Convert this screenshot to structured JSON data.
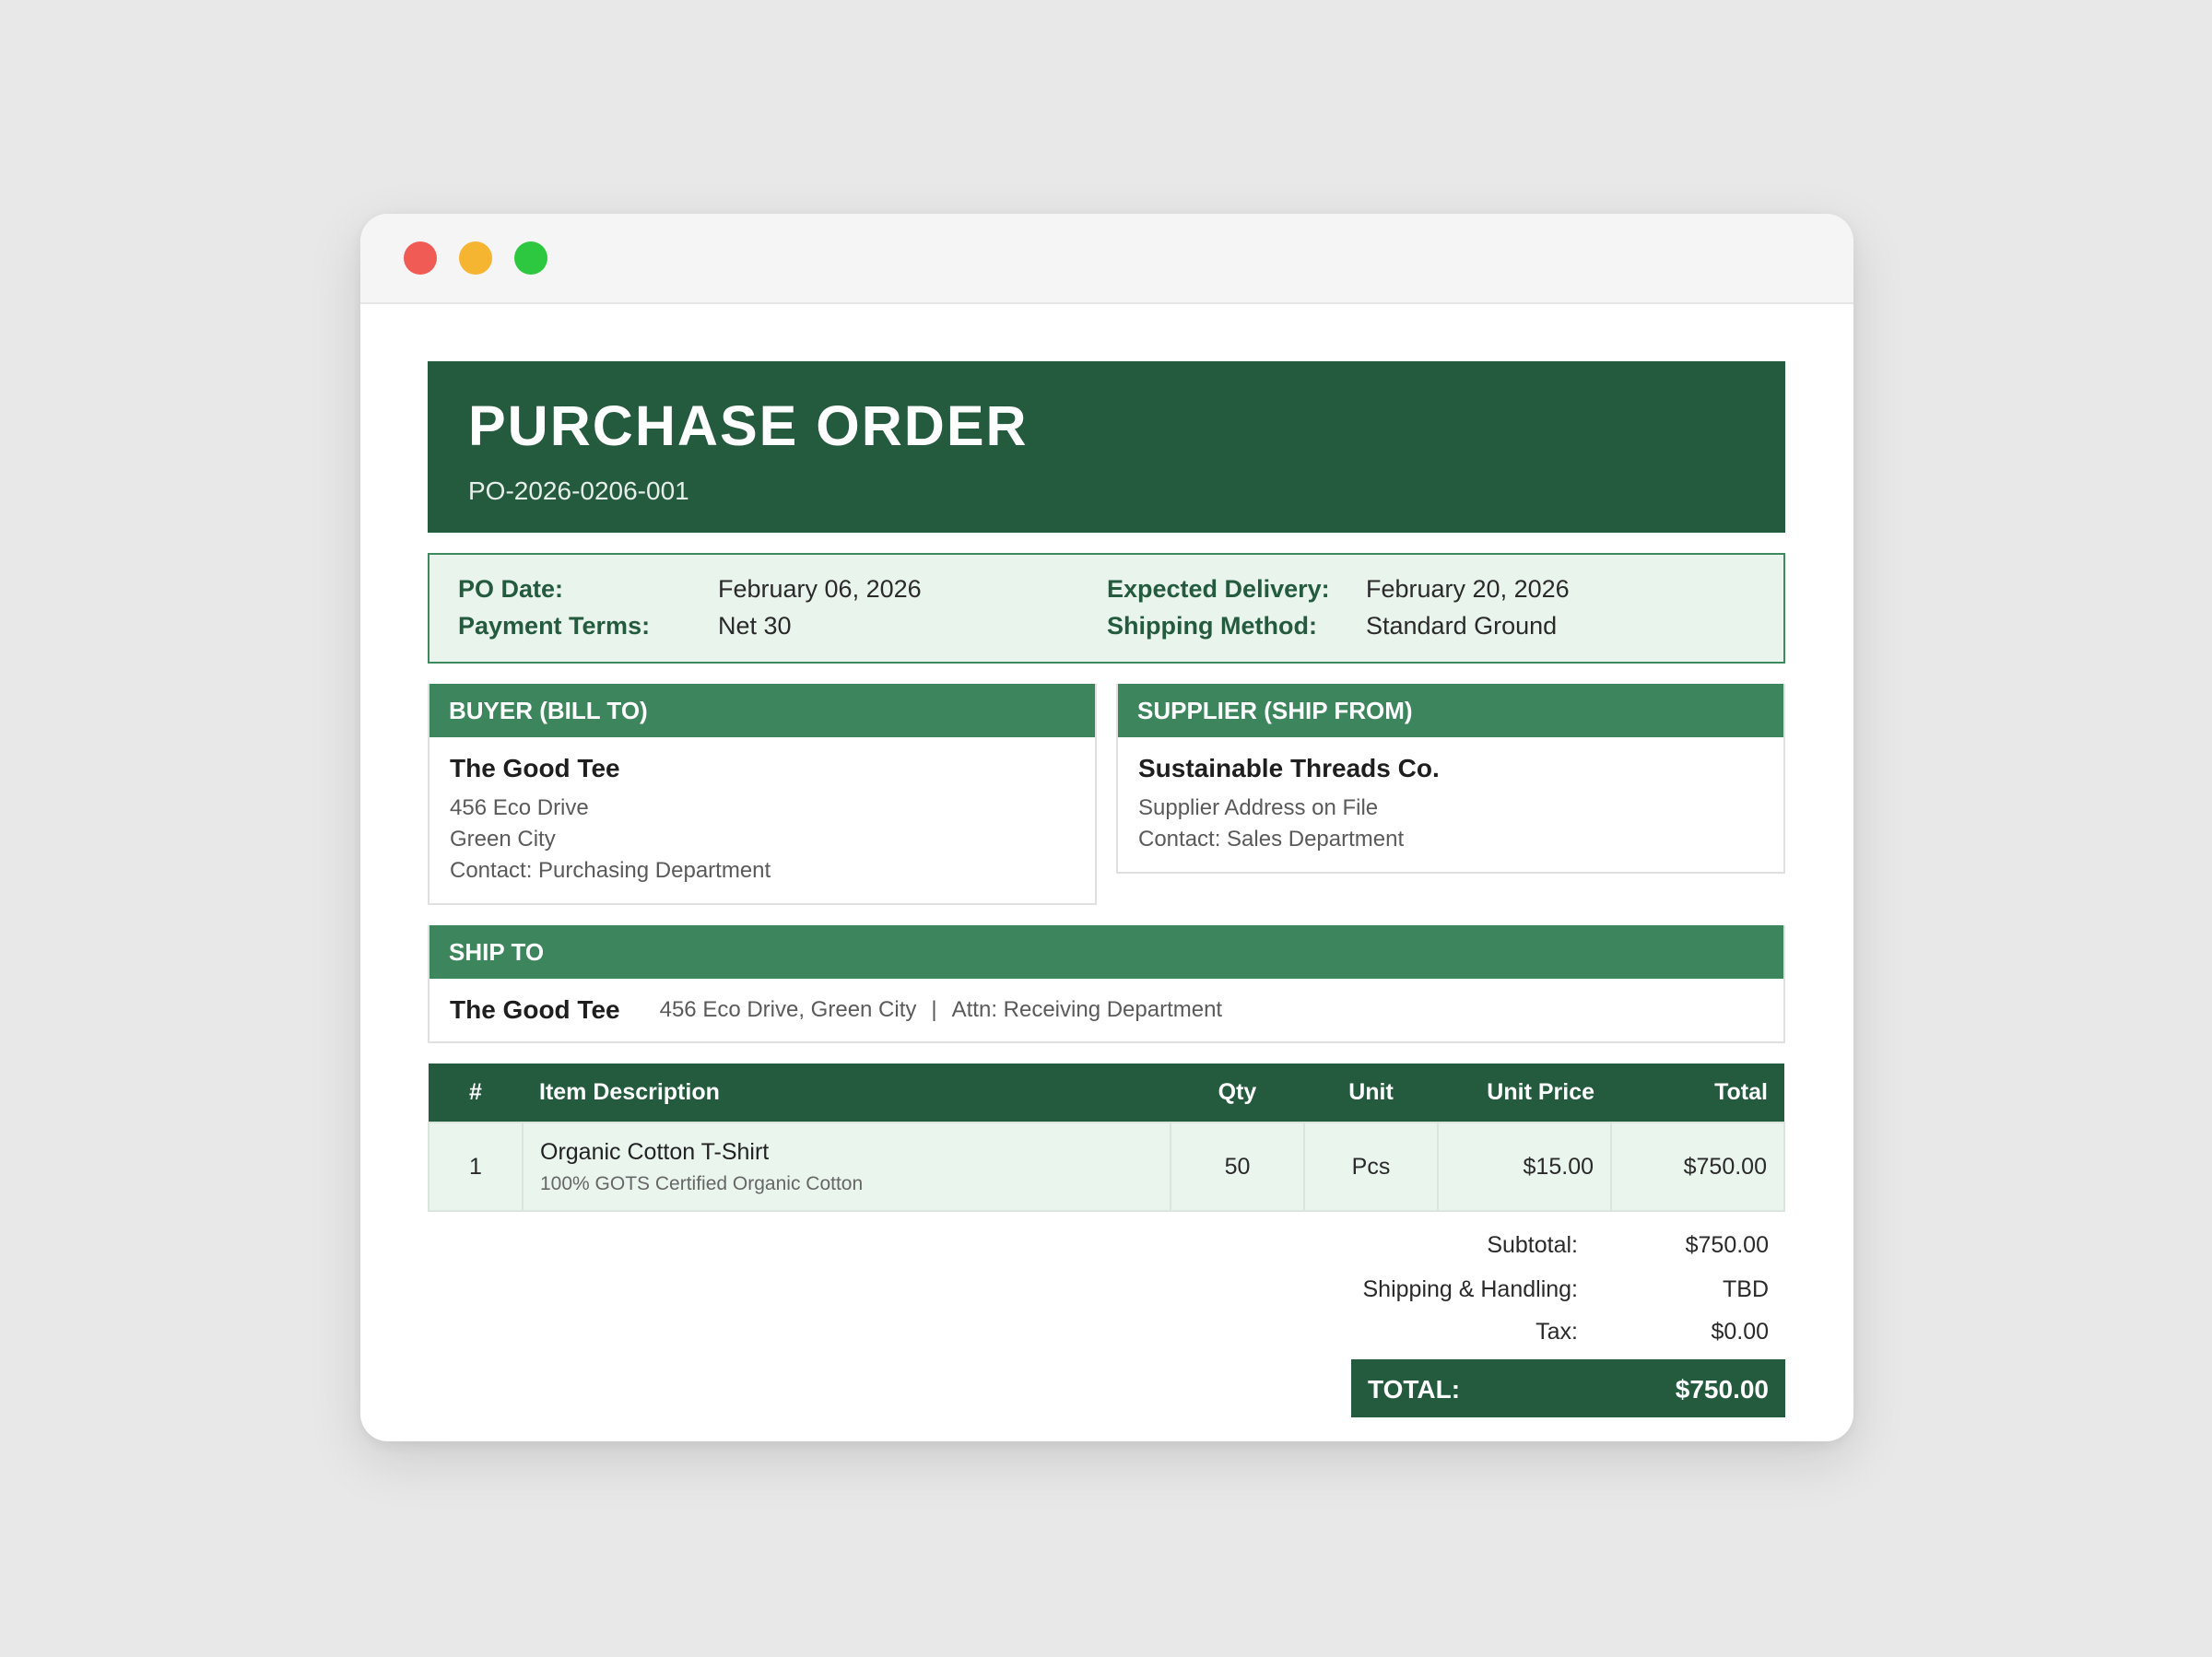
{
  "document": {
    "title": "PURCHASE ORDER",
    "po_number": "PO-2026-0206-001"
  },
  "meta": {
    "po_date_label": "PO Date:",
    "po_date": "February 06, 2026",
    "payment_terms_label": "Payment Terms:",
    "payment_terms": "Net 30",
    "expected_delivery_label": "Expected Delivery:",
    "expected_delivery": "February 20, 2026",
    "shipping_method_label": "Shipping Method:",
    "shipping_method": "Standard Ground"
  },
  "buyer": {
    "heading": "BUYER (BILL TO)",
    "name": "The Good Tee",
    "lines": [
      "456 Eco Drive",
      "Green City",
      "Contact: Purchasing Department"
    ]
  },
  "supplier": {
    "heading": "SUPPLIER (SHIP FROM)",
    "name": "Sustainable Threads Co.",
    "lines": [
      "Supplier Address on File",
      "Contact: Sales Department"
    ]
  },
  "ship_to": {
    "heading": "SHIP TO",
    "name": "The Good Tee",
    "address": "456 Eco Drive, Green City",
    "separator": "|",
    "attn": "Attn: Receiving Department"
  },
  "items_table": {
    "headers": [
      "#",
      "Item Description",
      "Qty",
      "Unit",
      "Unit Price",
      "Total"
    ],
    "rows": [
      {
        "num": "1",
        "name": "Organic Cotton T-Shirt",
        "description": "100% GOTS Certified Organic Cotton",
        "qty": "50",
        "unit": "Pcs",
        "unit_price": "$15.00",
        "total": "$750.00"
      }
    ]
  },
  "totals": {
    "subtotal_label": "Subtotal:",
    "subtotal": "$750.00",
    "shipping_label": "Shipping & Handling:",
    "shipping": "TBD",
    "tax_label": "Tax:",
    "tax": "$0.00",
    "total_label": "TOTAL:",
    "total": "$750.00"
  },
  "colors": {
    "dark_green": "#245a3e",
    "mid_green": "#3d855d",
    "light_green": "#e9f4ec",
    "window_close": "#f15b55",
    "window_minimize": "#f6b530",
    "window_maximize": "#2ec840"
  }
}
